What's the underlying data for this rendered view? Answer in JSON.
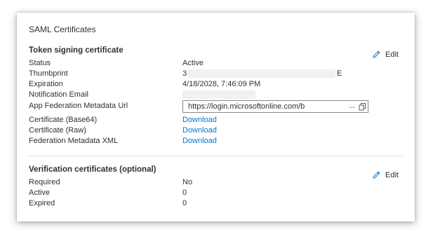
{
  "card": {
    "title": "SAML Certificates"
  },
  "token_signing": {
    "heading": "Token signing certificate",
    "edit_label": "Edit",
    "rows": {
      "status": {
        "label": "Status",
        "value": "Active"
      },
      "thumbprint": {
        "label": "Thumbprint",
        "value_start": "3",
        "value_end": "E"
      },
      "expiration": {
        "label": "Expiration",
        "value": "4/18/2028, 7:46:09 PM"
      },
      "notification_email": {
        "label": "Notification Email"
      },
      "metadata_url": {
        "label": "App Federation Metadata Url",
        "value": "https://login.microsoftonline.com/b",
        "ellipsis": "..."
      },
      "cert_base64": {
        "label": "Certificate (Base64)",
        "link": "Download"
      },
      "cert_raw": {
        "label": "Certificate (Raw)",
        "link": "Download"
      },
      "federation_xml": {
        "label": "Federation Metadata XML",
        "link": "Download"
      }
    }
  },
  "verification": {
    "heading": "Verification certificates (optional)",
    "edit_label": "Edit",
    "rows": {
      "required": {
        "label": "Required",
        "value": "No"
      },
      "active": {
        "label": "Active",
        "value": "0"
      },
      "expired": {
        "label": "Expired",
        "value": "0"
      }
    }
  },
  "icons": {
    "edit": "pencil-icon",
    "copy": "copy-icon"
  },
  "colors": {
    "link": "#0078d4",
    "text": "#323130",
    "edit_icon": "#0078d4"
  }
}
